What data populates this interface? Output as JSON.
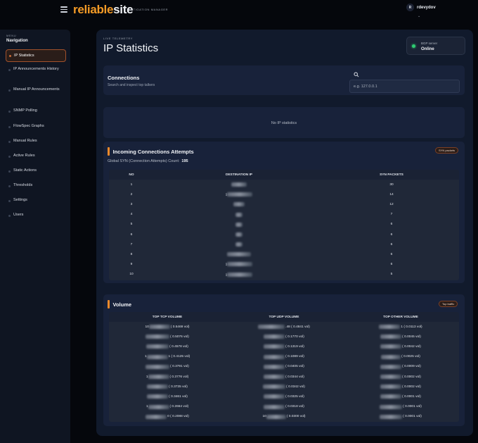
{
  "header": {
    "logo_part1": "reliable",
    "logo_part2": "site",
    "logo_sub": "MITIGATION MANAGER",
    "user_initial": "R",
    "user_name": "rdevydov",
    "user_caret": "⌄"
  },
  "sidebar": {
    "menu_label": "MENU",
    "title": "Navigation",
    "items": [
      {
        "label": "IP Statistics",
        "active": true
      },
      {
        "label": "IP Announcements History"
      },
      {
        "label": "Manual IP Announcements"
      },
      {
        "label": "SNMP Polling"
      },
      {
        "label": "FlowSpec Graphs"
      },
      {
        "label": "Manual Rules"
      },
      {
        "label": "Active Rules"
      },
      {
        "label": "Static Actions"
      },
      {
        "label": "Thresholds"
      },
      {
        "label": "Settings"
      },
      {
        "label": "Users"
      }
    ]
  },
  "page": {
    "eyebrow": "LIVE TELEMETRY",
    "title": "IP Statistics",
    "bgp_label": "BGP server",
    "bgp_status": "Online",
    "bgp_color": "#2ecc71"
  },
  "connections": {
    "title": "Connections",
    "subtitle": "Search and inspect top talkers",
    "search_placeholder": "e.g. 127.0.0.1",
    "empty": "No IP statistics"
  },
  "incoming": {
    "title": "Incoming Connections Attempts",
    "badge": "SYN packets",
    "global_label": "Global SYN (Connection Attempts) Count:",
    "global_value": "195",
    "columns": [
      "NO",
      "DESTINATION IP",
      "SYN PACKETS"
    ],
    "rows": [
      {
        "no": "1",
        "ip_prefix": "",
        "syn": "30"
      },
      {
        "no": "2",
        "ip_prefix": "1",
        "syn": "14"
      },
      {
        "no": "3",
        "ip_prefix": "",
        "syn": "12"
      },
      {
        "no": "4",
        "ip_prefix": "",
        "syn": "7"
      },
      {
        "no": "5",
        "ip_prefix": "",
        "syn": "6"
      },
      {
        "no": "6",
        "ip_prefix": "",
        "syn": "6"
      },
      {
        "no": "7",
        "ip_prefix": "",
        "syn": "6"
      },
      {
        "no": "8",
        "ip_prefix": "",
        "syn": "6"
      },
      {
        "no": "9",
        "ip_prefix": "1",
        "syn": "6"
      },
      {
        "no": "10",
        "ip_prefix": "1",
        "syn": "5"
      }
    ]
  },
  "volume": {
    "title": "Volume",
    "badge": "Top traffic",
    "columns": [
      "TOP TCP VOLUME",
      "TOP UDP VOLUME",
      "TOP OTHER VOLUME"
    ],
    "rows": [
      {
        "tcp_prefix": "10",
        "tcp": "( 0.5469 vol)",
        "udp_prefix": "",
        "udp": ".48 ( 0.4841 vol)",
        "other_prefix": "",
        "other": "1 ( 0.0113 vol)"
      },
      {
        "tcp_prefix": "",
        "tcp": "( 0.5076 vol)",
        "udp_prefix": "",
        "udp": "( 0.1770 vol)",
        "other_prefix": "",
        "other": "( 0.0045 vol)"
      },
      {
        "tcp_prefix": "",
        "tcp": "( 0.4578 vol)",
        "udp_prefix": "",
        "udp": "( 0.1319 vol)",
        "other_prefix": "",
        "other": "( 0.0042 vol)"
      },
      {
        "tcp_prefix": "1",
        "tcp": "1 ( 0.4125 vol)",
        "udp_prefix": "",
        "udp": "( 0.1089 vol)",
        "other_prefix": "",
        "other": "( 0.0025 vol)"
      },
      {
        "tcp_prefix": "",
        "tcp": "( 0.3791 vol)",
        "udp_prefix": "",
        "udp": "( 0.0405 vol)",
        "other_prefix": "",
        "other": "( 0.0009 vol)"
      },
      {
        "tcp_prefix": "1",
        "tcp": "( 0.3776 vol)",
        "udp_prefix": "",
        "udp": "( 0.0344 vol)",
        "other_prefix": "",
        "other": "( 0.0002 vol)"
      },
      {
        "tcp_prefix": "",
        "tcp": "( 0.3735 vol)",
        "udp_prefix": "",
        "udp": "( 0.0342 vol)",
        "other_prefix": "",
        "other": "( 0.0002 vol)"
      },
      {
        "tcp_prefix": "",
        "tcp": "( 0.3461 vol)",
        "udp_prefix": "",
        "udp": "( 0.0325 vol)",
        "other_prefix": "",
        "other": "( 0.0001 vol)"
      },
      {
        "tcp_prefix": "1",
        "tcp": "( 0.2664 vol)",
        "udp_prefix": "",
        "udp": "( 0.0318 vol)",
        "other_prefix": "",
        "other": "( 0.0001 vol)"
      },
      {
        "tcp_prefix": "",
        "tcp": "0 ( 0.2088 vol)",
        "udp_prefix": "10",
        "udp": "( 0.0300 vol)",
        "other_prefix": "",
        "other": "( 0.0001 vol)"
      }
    ]
  }
}
